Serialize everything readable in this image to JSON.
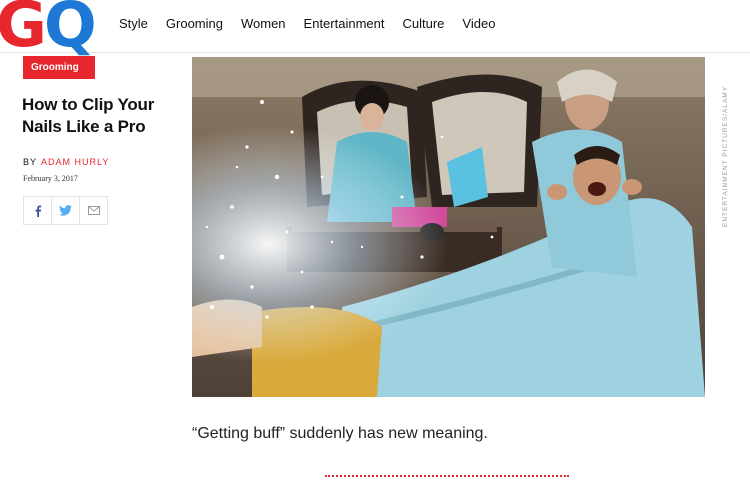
{
  "header": {
    "logo": "GQ",
    "nav": [
      "Style",
      "Grooming",
      "Women",
      "Entertainment",
      "Culture",
      "Video"
    ]
  },
  "article": {
    "category": "Grooming",
    "title": "How to Clip Your Nails Like a Pro",
    "by_label": "BY",
    "author": "ADAM HURLY",
    "date": "February 3, 2017",
    "photo_credit": "ENTERTAINMENT PICTURES/ALAMY",
    "caption": "“Getting buff” suddenly has new meaning."
  },
  "share": {
    "icons": [
      "facebook-icon",
      "twitter-icon",
      "email-icon"
    ]
  },
  "colors": {
    "brand_red": "#e8262e",
    "brand_blue": "#1e78d6",
    "facebook": "#3b5998",
    "twitter": "#55acee"
  }
}
